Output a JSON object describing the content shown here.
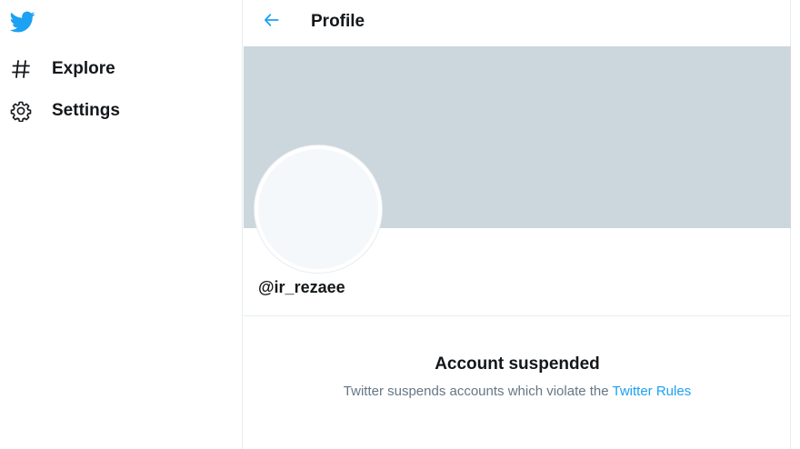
{
  "sidebar": {
    "logo_icon": "twitter-bird-icon",
    "items": [
      {
        "label": "Explore",
        "icon": "hashtag-icon"
      },
      {
        "label": "Settings",
        "icon": "gear-icon"
      }
    ]
  },
  "header": {
    "back_icon": "arrow-left-icon",
    "title": "Profile"
  },
  "profile": {
    "handle": "@ir_rezaee"
  },
  "notice": {
    "title": "Account suspended",
    "message": "Twitter suspends accounts which violate the ",
    "link_text": "Twitter Rules"
  },
  "colors": {
    "accent": "#1da1f2",
    "banner": "#ccd6dd",
    "avatar": "#f5f8fa",
    "text": "#14171a",
    "muted": "#657786"
  }
}
